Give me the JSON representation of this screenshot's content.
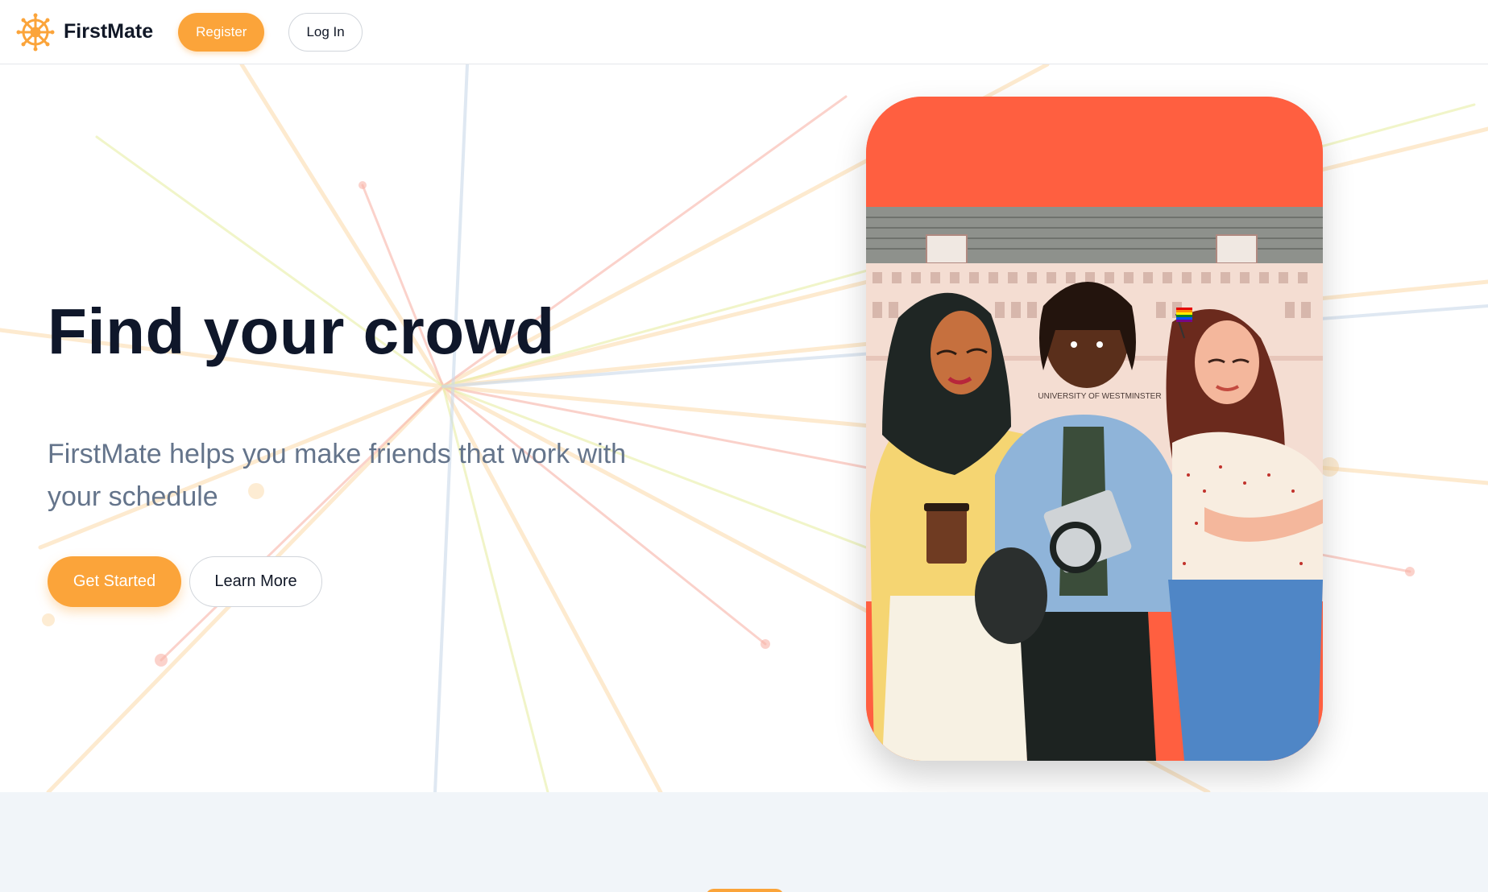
{
  "header": {
    "brand_name": "FirstMate",
    "register_label": "Register",
    "login_label": "Log In"
  },
  "hero": {
    "title": "Find your crowd",
    "subtitle": "FirstMate helps you make friends that work with your schedule",
    "get_started_label": "Get Started",
    "learn_more_label": "Learn More",
    "illustration_sign": "UNIVERSITY OF WESTMINSTER"
  },
  "colors": {
    "accent": "#fba43a",
    "title": "#0f172a",
    "subtitle": "#64748b",
    "card_background": "#ff5f40",
    "section_background": "#f1f5f9"
  },
  "icons": {
    "brand_logo": "ship-wheel-icon"
  }
}
